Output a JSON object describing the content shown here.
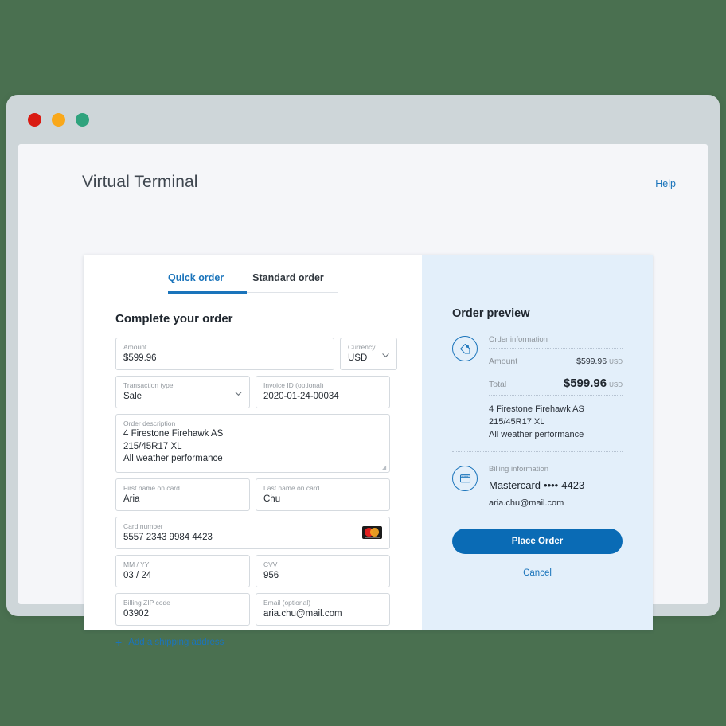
{
  "window": {
    "traffic_lights": [
      {
        "name": "close",
        "color": "#d91b12"
      },
      {
        "name": "minimize",
        "color": "#f9a81a"
      },
      {
        "name": "maximize",
        "color": "#2fa37d"
      }
    ]
  },
  "header": {
    "title": "Virtual Terminal",
    "help_label": "Help"
  },
  "tabs": [
    {
      "label": "Quick order",
      "active": true
    },
    {
      "label": "Standard order",
      "active": false
    }
  ],
  "form": {
    "heading": "Complete your order",
    "amount": {
      "label": "Amount",
      "value": "$599.96"
    },
    "currency": {
      "label": "Currency",
      "value": "USD"
    },
    "transaction_type": {
      "label": "Transaction type",
      "value": "Sale"
    },
    "invoice_id": {
      "label": "Invoice ID (optional)",
      "value": "2020-01-24-00034"
    },
    "order_description": {
      "label": "Order description",
      "lines": [
        "4 Firestone Firehawk AS",
        "215/45R17 XL",
        "All weather performance"
      ]
    },
    "first_name": {
      "label": "First name on card",
      "value": "Aria"
    },
    "last_name": {
      "label": "Last name on card",
      "value": "Chu"
    },
    "card_number": {
      "label": "Card number",
      "value": "5557 2343 9984 4423",
      "brand": "mastercard"
    },
    "expiry": {
      "label": "MM / YY",
      "value": "03 / 24"
    },
    "cvv": {
      "label": "CVV",
      "value": "956"
    },
    "billing_zip": {
      "label": "Billing ZIP code",
      "value": "03902"
    },
    "email": {
      "label": "Email (optional)",
      "value": "aria.chu@mail.com"
    },
    "add_shipping_label": "Add a shipping address"
  },
  "preview": {
    "title": "Order preview",
    "order_information_caption": "Order information",
    "amount_row": {
      "label": "Amount",
      "value": "$599.96",
      "currency": "USD"
    },
    "total_row": {
      "label": "Total",
      "value": "$599.96",
      "currency": "USD"
    },
    "description_lines": [
      "4 Firestone Firehawk AS",
      "215/45R17 XL",
      "All weather performance"
    ],
    "billing_caption": "Billing information",
    "card_brand": "Mastercard",
    "card_mask": "••••",
    "card_last4": "4423",
    "email": "aria.chu@mail.com",
    "place_order_label": "Place Order",
    "cancel_label": "Cancel"
  },
  "colors": {
    "background": "#4a7050",
    "accent_blue": "#1a74bb",
    "button_blue": "#0a6bb5",
    "panel_blue": "#e3effa"
  }
}
